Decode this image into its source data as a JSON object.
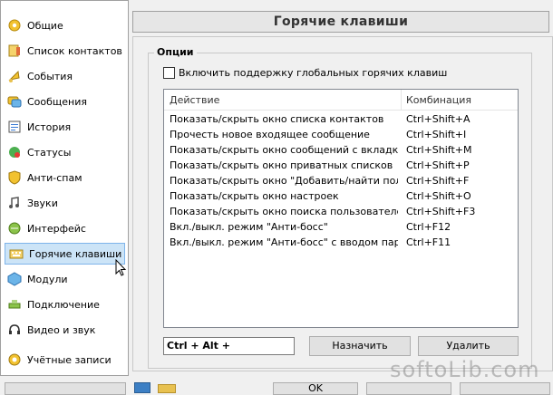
{
  "sidebar": {
    "items": [
      {
        "label": "Общие",
        "icon": "general-icon"
      },
      {
        "label": "Список контактов",
        "icon": "contacts-icon"
      },
      {
        "label": "События",
        "icon": "events-icon"
      },
      {
        "label": "Сообщения",
        "icon": "messages-icon"
      },
      {
        "label": "История",
        "icon": "history-icon"
      },
      {
        "label": "Статусы",
        "icon": "status-icon"
      },
      {
        "label": "Анти-спам",
        "icon": "antispam-icon"
      },
      {
        "label": "Звуки",
        "icon": "sounds-icon"
      },
      {
        "label": "Интерфейс",
        "icon": "interface-icon"
      },
      {
        "label": "Горячие клавиши",
        "icon": "hotkeys-icon",
        "selected": true
      },
      {
        "label": "Модули",
        "icon": "modules-icon"
      },
      {
        "label": "Подключение",
        "icon": "connection-icon"
      },
      {
        "label": "Видео и звук",
        "icon": "video-audio-icon"
      },
      {
        "label": "Учётные записи",
        "icon": "accounts-icon"
      }
    ]
  },
  "header": {
    "title": "Горячие клавиши"
  },
  "options": {
    "group_title": "Опции",
    "global_hotkeys_label": "Включить поддержку глобальных горячих клавиш",
    "global_hotkeys_checked": false
  },
  "table": {
    "columns": [
      "Действие",
      "Комбинация"
    ],
    "rows": [
      [
        "Показать/скрыть окно списка контактов",
        "Ctrl+Shift+A"
      ],
      [
        "Прочесть новое входящее сообщение",
        "Ctrl+Shift+I"
      ],
      [
        "Показать/скрыть окно сообщений с вкладками",
        "Ctrl+Shift+M"
      ],
      [
        "Показать/скрыть окно приватных списков",
        "Ctrl+Shift+P"
      ],
      [
        "Показать/скрыть окно \"Добавить/найти польз...",
        "Ctrl+Shift+F"
      ],
      [
        "Показать/скрыть окно настроек",
        "Ctrl+Shift+O"
      ],
      [
        "Показать/скрыть окно поиска пользователей ...",
        "Ctrl+Shift+F3"
      ],
      [
        "Вкл./выкл. режим \"Анти-босс\"",
        "Ctrl+F12"
      ],
      [
        "Вкл./выкл. режим \"Анти-босс\" с вводом пароля...",
        "Ctrl+F11"
      ]
    ]
  },
  "hotkey_field": {
    "value": "Ctrl + Alt +"
  },
  "buttons": {
    "assign": "Назначить",
    "delete": "Удалить",
    "ok": "OK"
  },
  "watermark": "softoLib.com"
}
